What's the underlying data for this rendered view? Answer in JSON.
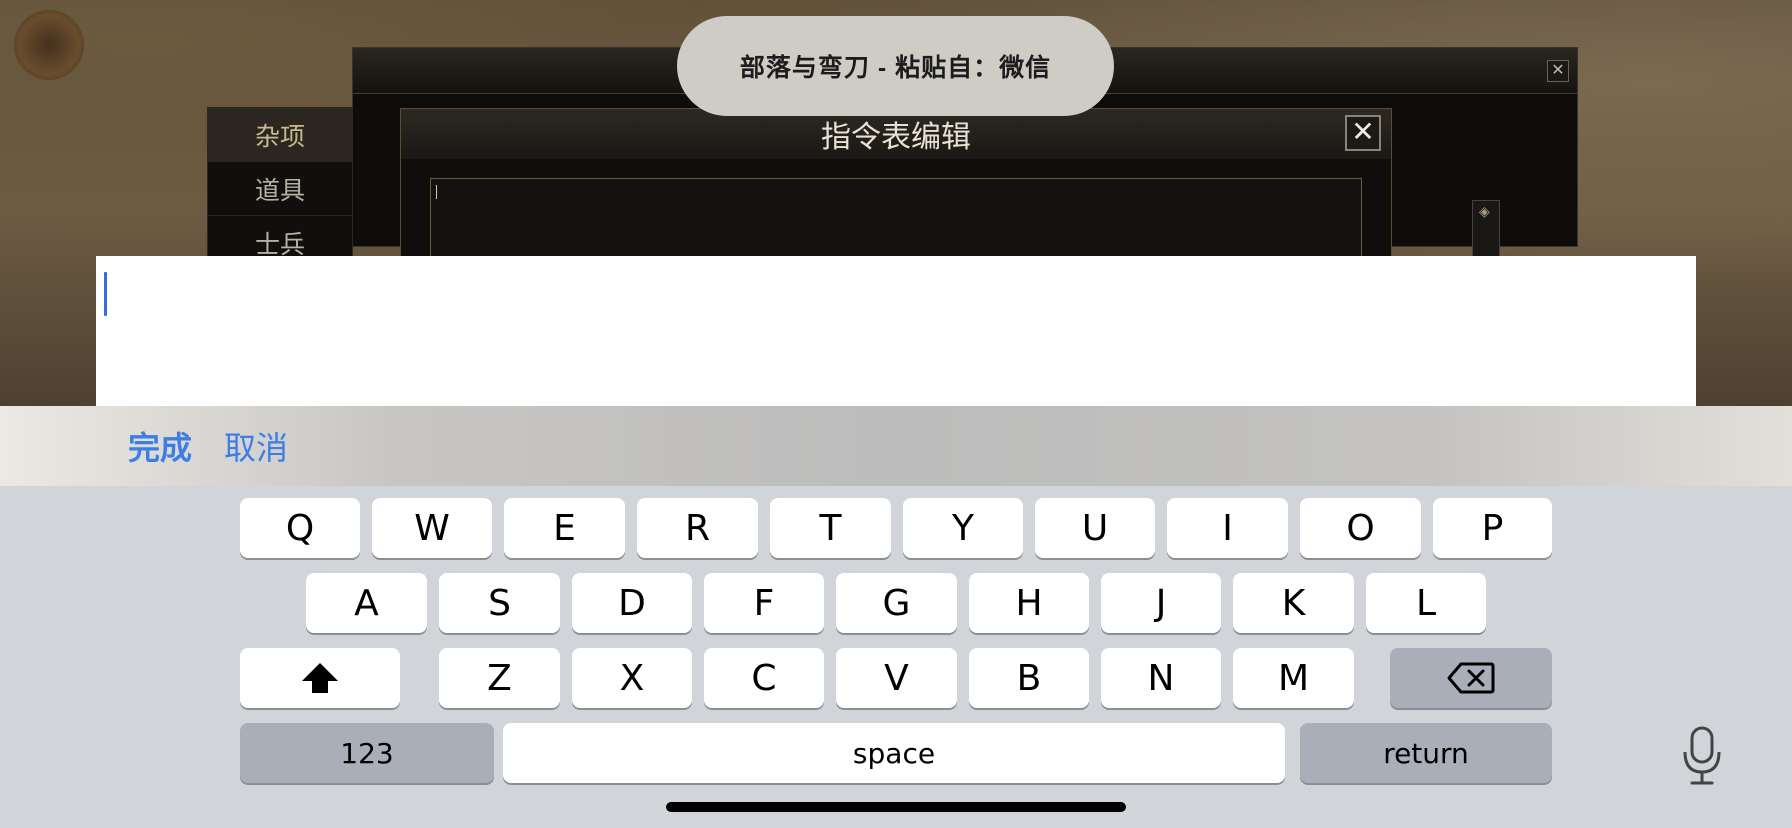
{
  "toast": {
    "text": "部落与弯刀 - 粘贴自：微信"
  },
  "side_menu": {
    "items": [
      "杂项",
      "道具",
      "士兵"
    ]
  },
  "dialog": {
    "title": "指令表编辑",
    "close": "✕"
  },
  "outer_window": {
    "close": "✕"
  },
  "accessory": {
    "done": "完成",
    "cancel": "取消"
  },
  "keyboard": {
    "row1": [
      "Q",
      "W",
      "E",
      "R",
      "T",
      "Y",
      "U",
      "I",
      "O",
      "P"
    ],
    "row2": [
      "A",
      "S",
      "D",
      "F",
      "G",
      "H",
      "J",
      "K",
      "L"
    ],
    "row3": [
      "Z",
      "X",
      "C",
      "V",
      "B",
      "N",
      "M"
    ],
    "numbers": "123",
    "space": "space",
    "return": "return"
  },
  "colors": {
    "accent": "#3d7ee6",
    "caret": "#3a6ae0",
    "keyboard_bg": "#d1d4d9",
    "key_dark": "#a9aeb8"
  },
  "icons": {
    "shift": "shift-arrow-icon",
    "backspace": "backspace-icon",
    "mic": "microphone-icon"
  }
}
